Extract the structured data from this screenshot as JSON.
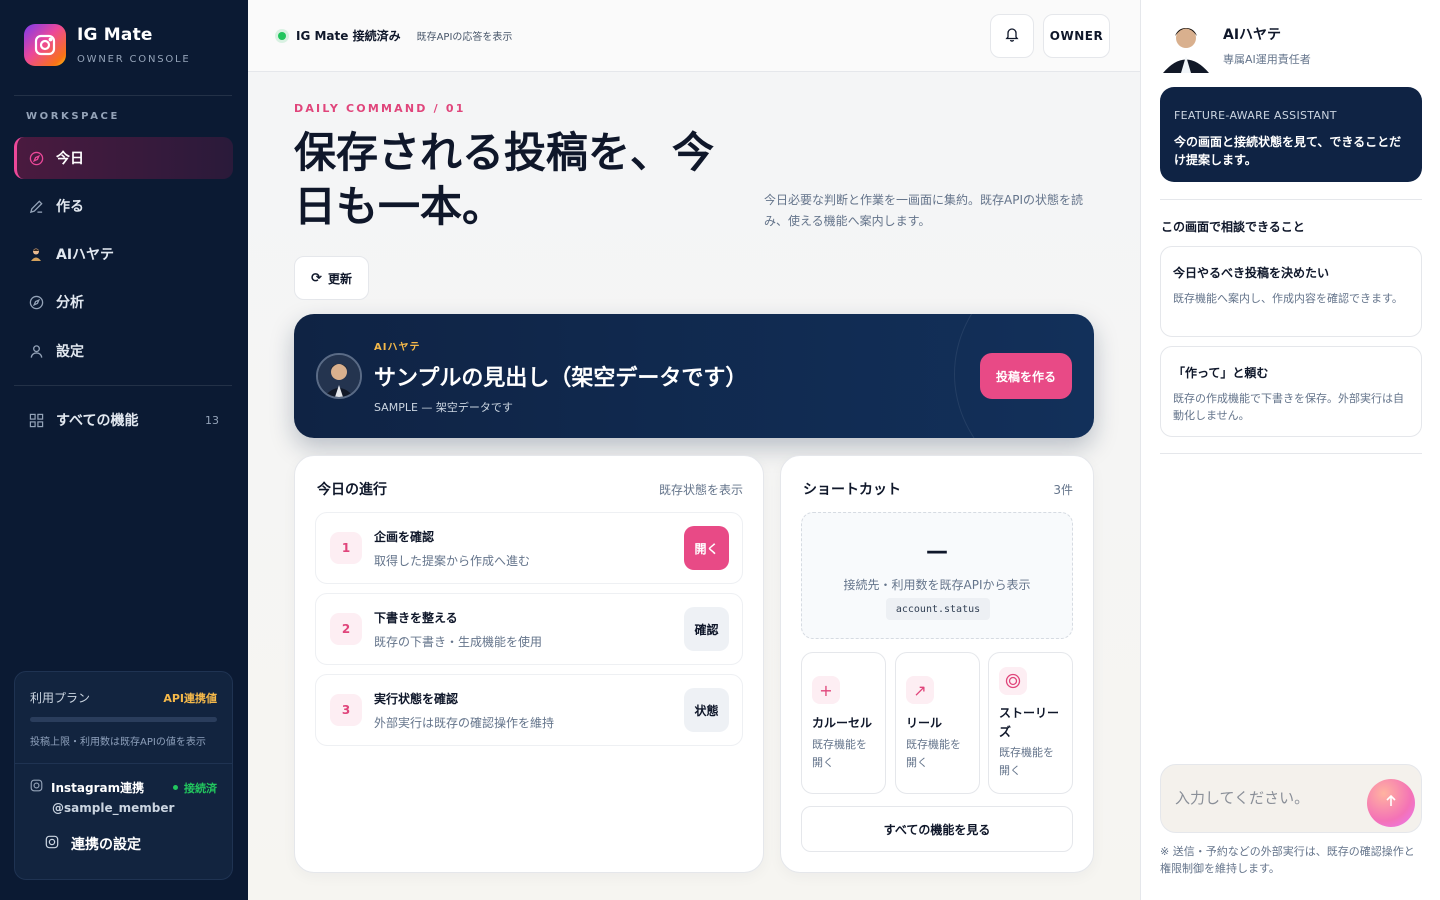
{
  "brand": {
    "name": "IG Mate",
    "subtitle": "OWNER CONSOLE"
  },
  "sidebar": {
    "workspace_label": "WORKSPACE",
    "items": [
      {
        "label": "今日",
        "icon": "compass-icon",
        "active": true
      },
      {
        "label": "作る",
        "icon": "pencil-icon"
      },
      {
        "label": "AIハヤテ",
        "icon": "ai-avatar-icon"
      },
      {
        "label": "分析",
        "icon": "compass-icon"
      },
      {
        "label": "設定",
        "icon": "user-icon"
      }
    ],
    "all_features": {
      "label": "すべての機能",
      "count": "13"
    },
    "plan": {
      "title": "利用プラン",
      "status": "API連携値",
      "progress": 0,
      "note": "投稿上限・利用数は既存APIの値を表示"
    },
    "instagram": {
      "label": "Instagram連携",
      "status": "接続済",
      "user": "@sample_member",
      "settings_label": "連携の設定"
    }
  },
  "topbar": {
    "connection": "IG Mate 接続済み",
    "connection_note": "既存APIの応答を表示",
    "owner_label": "OWNER"
  },
  "page": {
    "eyebrow": "DAILY COMMAND / 01",
    "headline_line1": "保存される投稿を、今",
    "headline_line2": "日も一本。",
    "lede": "今日必要な判断と作業を一画面に集約。既存APIの状態を読み、使える機能へ案内します。",
    "refresh_label": "更新"
  },
  "hero": {
    "label": "AIハヤテ",
    "title": "サンプルの見出し（架空データです）",
    "subtitle": "SAMPLE — 架空データです",
    "button": "投稿を作る"
  },
  "progress": {
    "title": "今日の進行",
    "meta": "既存状態を表示",
    "steps": [
      {
        "num": "1",
        "title": "企画を確認",
        "desc": "取得した提案から作成へ進む",
        "button": "開く"
      },
      {
        "num": "2",
        "title": "下書きを整える",
        "desc": "既存の下書き・生成機能を使用",
        "button": "確認"
      },
      {
        "num": "3",
        "title": "実行状態を確認",
        "desc": "外部実行は既存の確認操作を維持",
        "button": "状態"
      }
    ]
  },
  "shortcuts": {
    "title": "ショートカット",
    "count": "3件",
    "status_dash": "—",
    "status_text": "接続先・利用数を既存APIから表示",
    "status_code": "account.status",
    "tiles": [
      {
        "icon": "plus-icon",
        "title": "カルーセル",
        "desc": "既存機能を開く"
      },
      {
        "icon": "arrow-up-right-icon",
        "title": "リール",
        "desc": "既存機能を開く"
      },
      {
        "icon": "ring-icon",
        "title": "ストーリーズ",
        "desc": "既存機能を開く"
      }
    ],
    "all_button": "すべての機能を見る"
  },
  "assistant": {
    "name": "AIハヤテ",
    "role": "専属AI運用責任者",
    "box_label": "FEATURE-AWARE ASSISTANT",
    "box_text": "今の画面と接続状態を見て、できることだけ提案します。",
    "section": "この画面で相談できること",
    "suggestions": [
      {
        "title": "今日やるべき投稿を決めたい",
        "desc": "既存機能へ案内し、作成内容を確認できます。"
      },
      {
        "title": "「作って」と頼む",
        "desc": "既存の作成機能で下書きを保存。外部実行は自動化しません。"
      }
    ],
    "input_placeholder": "入力してください。",
    "note": "※ 送信・予約などの外部実行は、既存の確認操作と権限制御を維持します。"
  },
  "colors": {
    "accent": "#e84a86",
    "navy": "#0f2344",
    "sidebar": "#0b1a33",
    "success": "#22c55e",
    "gold": "#f5b94a"
  }
}
